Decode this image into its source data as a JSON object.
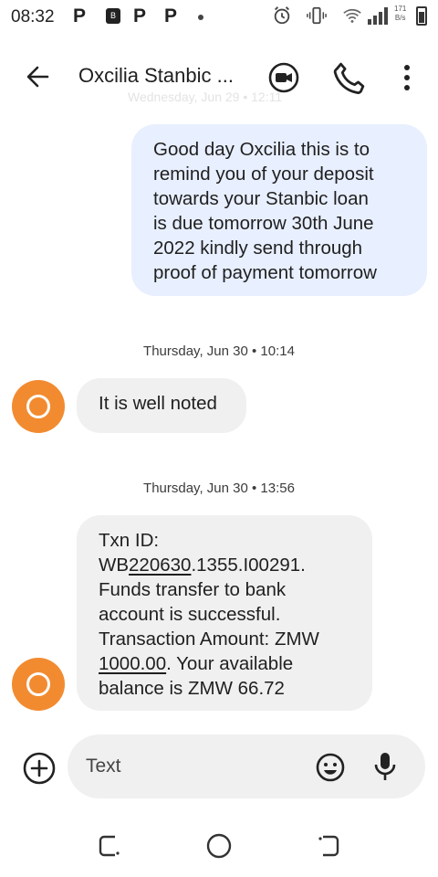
{
  "status_bar": {
    "time": "08:32",
    "speed_value": "171",
    "speed_unit": "B/s"
  },
  "header": {
    "title": "Oxcilia Stanbic ...",
    "icons": [
      "back-arrow-icon",
      "video-call-icon",
      "phone-icon",
      "more-vert-icon"
    ]
  },
  "faded_timestamp": "Wednesday, Jun 29 • 12:11",
  "messages": [
    {
      "direction": "outgoing",
      "lines": [
        "Good day Oxcilia this is to",
        "remind you of your deposit",
        "towards your Stanbic loan",
        "is due tomorrow 30th June",
        "2022 kindly send through",
        "proof of payment tomorrow"
      ]
    },
    {
      "direction": "incoming",
      "timestamp": "Thursday, Jun 30 • 10:14",
      "text": "It is well noted"
    },
    {
      "direction": "incoming",
      "timestamp": "Thursday, Jun 30 • 13:56",
      "line1": "Txn ID:",
      "txn_prefix": "WB",
      "txn_link": "220630",
      "txn_suffix": ".1355.I00291.",
      "line3": "Funds transfer to bank",
      "line4": "account is successful.",
      "line5": "Transaction Amount: ZMW",
      "amount_link": "1000.00",
      "line6_rest": ". Your available",
      "line7": "balance is ZMW 66.72"
    }
  ],
  "compose": {
    "placeholder": "Text"
  },
  "colors": {
    "outgoing_bubble": "#e8efff",
    "incoming_bubble": "#f0f0f0",
    "avatar": "#f28b30"
  }
}
